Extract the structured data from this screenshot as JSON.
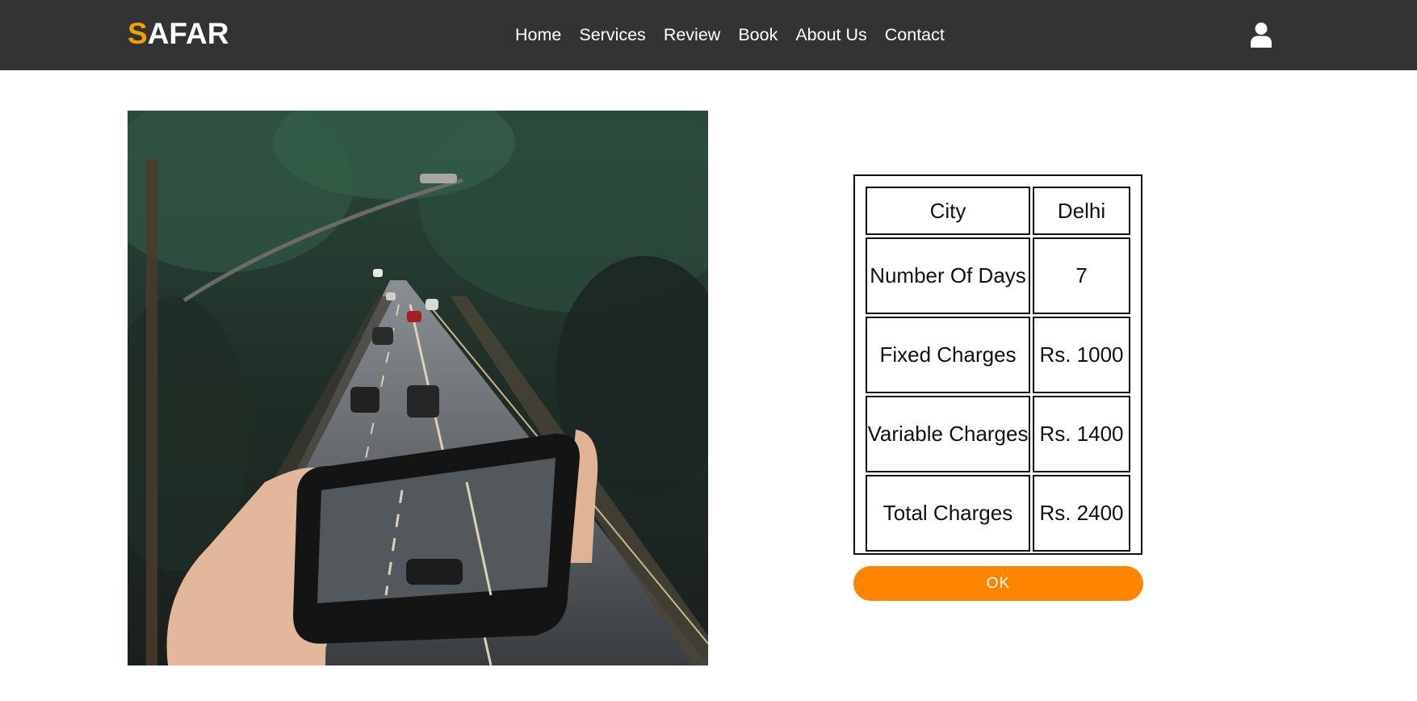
{
  "header": {
    "logo_first": "S",
    "logo_rest": "AFAR",
    "nav": [
      "Home",
      "Services",
      "Review",
      "Book",
      "About Us",
      "Contact"
    ],
    "user_icon": "user-icon"
  },
  "summary": {
    "rows": [
      {
        "label": "City",
        "value": "Delhi"
      },
      {
        "label": "Number Of Days",
        "value": "7"
      },
      {
        "label": "Fixed Charges",
        "value": "Rs. 1000"
      },
      {
        "label": "Variable Charges",
        "value": "Rs. 1400"
      },
      {
        "label": "Total Charges",
        "value": "Rs. 2400"
      }
    ]
  },
  "actions": {
    "ok_label": "OK"
  },
  "colors": {
    "navbar": "#333333",
    "logo_accent": "#f5a000",
    "button": "#ff8400"
  }
}
